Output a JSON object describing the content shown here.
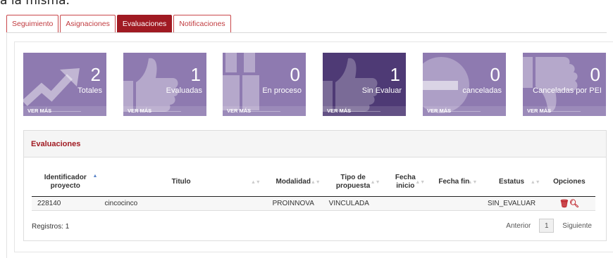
{
  "top_fragment": "a la misma.",
  "tabs": [
    {
      "label": "Seguimiento",
      "active": false
    },
    {
      "label": "Asignaciones",
      "active": false
    },
    {
      "label": "Evaluaciones",
      "active": true
    },
    {
      "label": "Notificaciones",
      "active": false
    }
  ],
  "tiles": [
    {
      "count": "2",
      "label": "Totales",
      "more": "VER MÁS",
      "icon": "trending-up-icon"
    },
    {
      "count": "1",
      "label": "Evaluadas",
      "more": "VER MÁS",
      "icon": "thumbs-up-icon"
    },
    {
      "count": "0",
      "label": "En proceso",
      "more": "VER MÁS",
      "icon": "binoculars-icon"
    },
    {
      "count": "1",
      "label": "Sin Evaluar",
      "more": "VER MÁS",
      "icon": "thumbs-up-icon"
    },
    {
      "count": "0",
      "label": "canceladas",
      "more": "VER MÁS",
      "icon": "minus-circle-icon"
    },
    {
      "count": "0",
      "label": "Canceladas por PEI",
      "more": "VER MÁS",
      "icon": "thumbs-down-icon"
    }
  ],
  "evaluaciones": {
    "title": "Evaluaciones",
    "columns": [
      "Identificador proyecto",
      "Titulo",
      "Modalidad",
      "Tipo de propuesta",
      "Fecha inicio",
      "Fecha fin",
      "Estatus",
      "Opciones"
    ],
    "rows": [
      {
        "id": "228140",
        "titulo": "cincocinco",
        "modalidad": "PROINNOVA",
        "tipo": "VINCULADA",
        "inicio": "",
        "fin": "",
        "estatus": "SIN_EVALUAR"
      }
    ],
    "registros": "Registros: 1",
    "pager": {
      "prev": "Anterior",
      "page": "1",
      "next": "Siguiente"
    }
  },
  "colors": {
    "accent": "#a01a22",
    "tile": "#8e7ab0",
    "tile_active": "#4e3a75"
  }
}
